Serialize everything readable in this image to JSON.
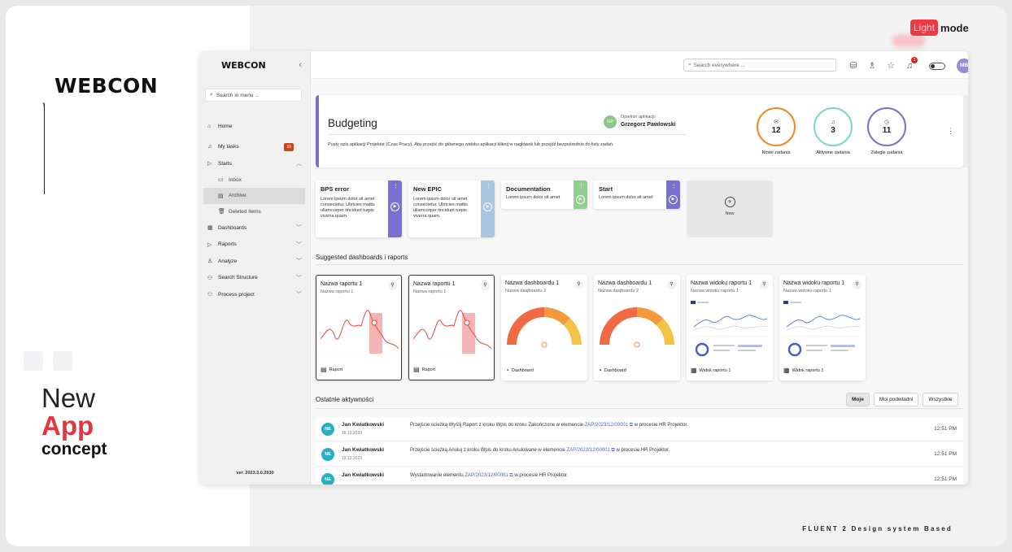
{
  "slide": {
    "brand": "WEBCON",
    "concept": {
      "line1": "New",
      "line2": "App",
      "line3": "concept"
    },
    "lightmode": {
      "pill": "Light",
      "rest": "mode"
    },
    "footer": "FLUENT 2 Design system Based"
  },
  "sidebar": {
    "logo": "WEBCON",
    "collapse_icon": "chevron-left-icon",
    "search_placeholder": "Search in menu ...",
    "items": [
      {
        "label": "Home",
        "icon": "home-icon"
      },
      {
        "label": "My tasks",
        "icon": "bell-icon",
        "badge": "15"
      },
      {
        "label": "Starts",
        "icon": "play-outline-icon",
        "expanded": true
      },
      {
        "label": "Inbox",
        "icon": "inbox-icon"
      },
      {
        "label": "Archive",
        "icon": "archive-icon",
        "active": true
      },
      {
        "label": "Deleted items",
        "icon": "trash-icon"
      },
      {
        "label": "Dashboards",
        "icon": "dashboard-icon"
      },
      {
        "label": "Raports",
        "icon": "play-outline-icon"
      },
      {
        "label": "Analyze",
        "icon": "people-icon"
      },
      {
        "label": "Search Structure",
        "icon": "org-icon"
      },
      {
        "label": "Process project",
        "icon": "org-icon"
      }
    ],
    "version": "ver. 2023.3.0.2930"
  },
  "topbar": {
    "search_placeholder": "Search everywhere ...",
    "bell_badge": "1",
    "avatar": "MB"
  },
  "header": {
    "title": "Budgeting",
    "description": "Pusty opis aplikacji Projektor (Czas Pracy). Aby przejść do głównego widoku aplikacji kliknij w nagłówek lub przejdź bezpośrednio do listy zadań.",
    "owner_label": "Opiekun aplikacji:",
    "owner_name": "Grzegorz Pawlowski",
    "owner_initials": "GP",
    "stats": [
      {
        "value": "12",
        "label": "Nowe zadania",
        "color": "#f08a24"
      },
      {
        "value": "3",
        "label": "Aktywne zadania",
        "color": "#7fd3d0"
      },
      {
        "value": "11",
        "label": "Zaległe zadania",
        "color": "#7b6fd1"
      }
    ]
  },
  "tiles": [
    {
      "title": "BPS error",
      "desc": "Lorem ipsum dolor sit amet consectetur. Ultricies mattis ullamcorper tincidunt turpis viverra quam.",
      "color": "#7b6fd1"
    },
    {
      "title": "New EPIC",
      "desc": "Lorem ipsum dolor sit amet consectetur. Ultricies mattis ullamcorper tincidunt turpis viverra quam.",
      "color": "#a9c5e2"
    },
    {
      "title": "Documentation",
      "desc": "Lorem ipsum dolor sit amet",
      "color": "#8fcf8f"
    },
    {
      "title": "Start",
      "desc": "Lorem ipsum dolor sit amet",
      "color": "#7b6fd1"
    }
  ],
  "new_tile": "New",
  "suggested_title": "Suggested dashboards i raports",
  "cards": [
    {
      "title": "Nazwa raportu 1",
      "sub": "Nazwa raportu 1",
      "foot": "Raport",
      "kind": "report"
    },
    {
      "title": "Nazwa raportu 1",
      "sub": "Nazwa raportu 1",
      "foot": "Raport",
      "kind": "report"
    },
    {
      "title": "Nazwa dashboardu 1",
      "sub": "Nazwa dasjboardu 2",
      "foot": "Dashboard",
      "kind": "gauge"
    },
    {
      "title": "Nazwa dashboardu 1",
      "sub": "Nazwa dasjboardu 2",
      "foot": "Dashboard",
      "kind": "gauge"
    },
    {
      "title": "Nazwa widoku raportu 1",
      "sub": "Nazwa widoku raportu 1",
      "foot": "Widok raportu 1",
      "kind": "view"
    },
    {
      "title": "Nazwa widoku raportu 1",
      "sub": "Nazwa widoku raportu 1",
      "foot": "Widok raportu 1",
      "kind": "view"
    }
  ],
  "activity": {
    "title": "Ostatnie aktywności",
    "tabs": [
      "Moje",
      "Moi podwładni",
      "Wszystkie"
    ],
    "rows": [
      {
        "initials": "NE",
        "name": "Jan Kwiatkowski",
        "date": "19.12.2023",
        "pre": "Przejście ścieżką Wyślij Raport z kroku Wpis do kroku Zakończone w elemencie",
        "link": "ZAP/2023/12/00001",
        "post": "w procesie HR Projektor.",
        "time": "12:51 PM"
      },
      {
        "initials": "NE",
        "name": "Jan Kwiatkowski",
        "date": "19.12.2023",
        "pre": "Przejście ścieżką Anuluj z kroku Wpis do kroku Anulowane w elemencie",
        "link": "ZAP/2023/12/00001",
        "post": "w procesie HR Projektor.",
        "time": "12:51 PM"
      },
      {
        "initials": "NE",
        "name": "Jan Kwiatkowski",
        "date": "",
        "pre": "Wystartowanie elementu",
        "link": "ZAP/2023/12/00001",
        "post": "w procesie HR Projektor.",
        "time": "12:51 PM"
      }
    ]
  }
}
